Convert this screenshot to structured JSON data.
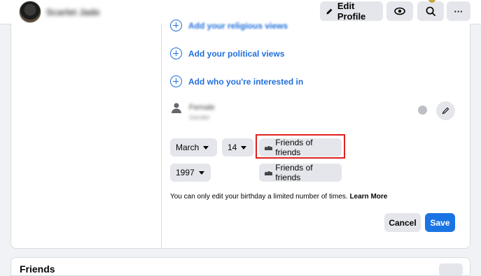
{
  "header": {
    "profile_name": "Scarlet Jade",
    "edit_profile_label": "Edit Profile",
    "eye_icon": "eye-icon",
    "search_icon": "search-icon",
    "more_label": "···"
  },
  "about": {
    "religious_label": "Add your religious views",
    "political_label": "Add your political views",
    "interested_label": "Add who you're interested in",
    "gender_value": "Female",
    "gender_sub": "Gender"
  },
  "birthday": {
    "month": "March",
    "day": "14",
    "year": "1997",
    "date_audience": "Friends of friends",
    "year_audience": "Friends of friends",
    "note": "You can only edit your birthday a limited number of times.",
    "learn_more": "Learn More"
  },
  "actions": {
    "cancel_label": "Cancel",
    "save_label": "Save"
  },
  "next_section": {
    "title": "Friends"
  },
  "colors": {
    "accent": "#1b74e4",
    "link": "#216fdb",
    "highlight_border": "#e02020"
  }
}
